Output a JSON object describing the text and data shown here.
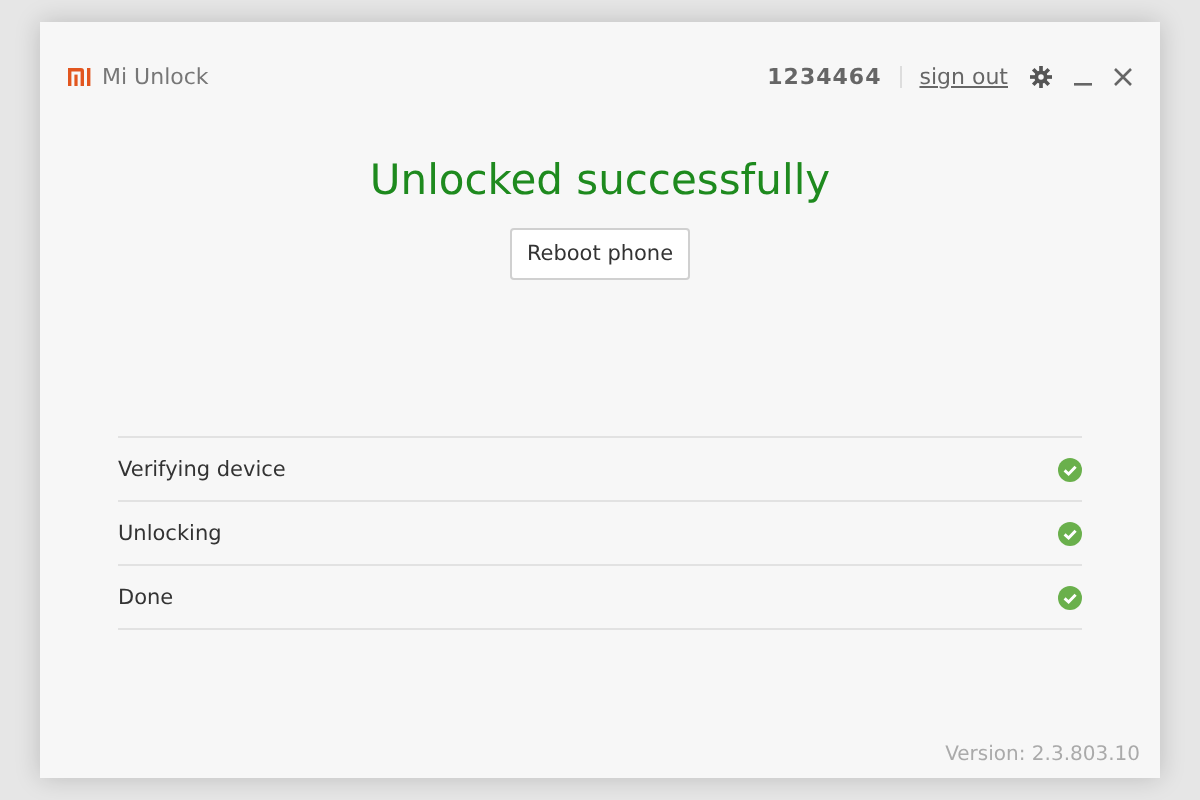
{
  "window": {
    "title": "Mi Unlock",
    "account": "1234464",
    "sign_out": "sign out"
  },
  "heading": "Unlocked successfully",
  "reboot_button": "Reboot phone",
  "steps": [
    {
      "label": "Verifying device",
      "done": true
    },
    {
      "label": "Unlocking",
      "done": true
    },
    {
      "label": "Done",
      "done": true
    }
  ],
  "version": "Version: 2.3.803.10"
}
